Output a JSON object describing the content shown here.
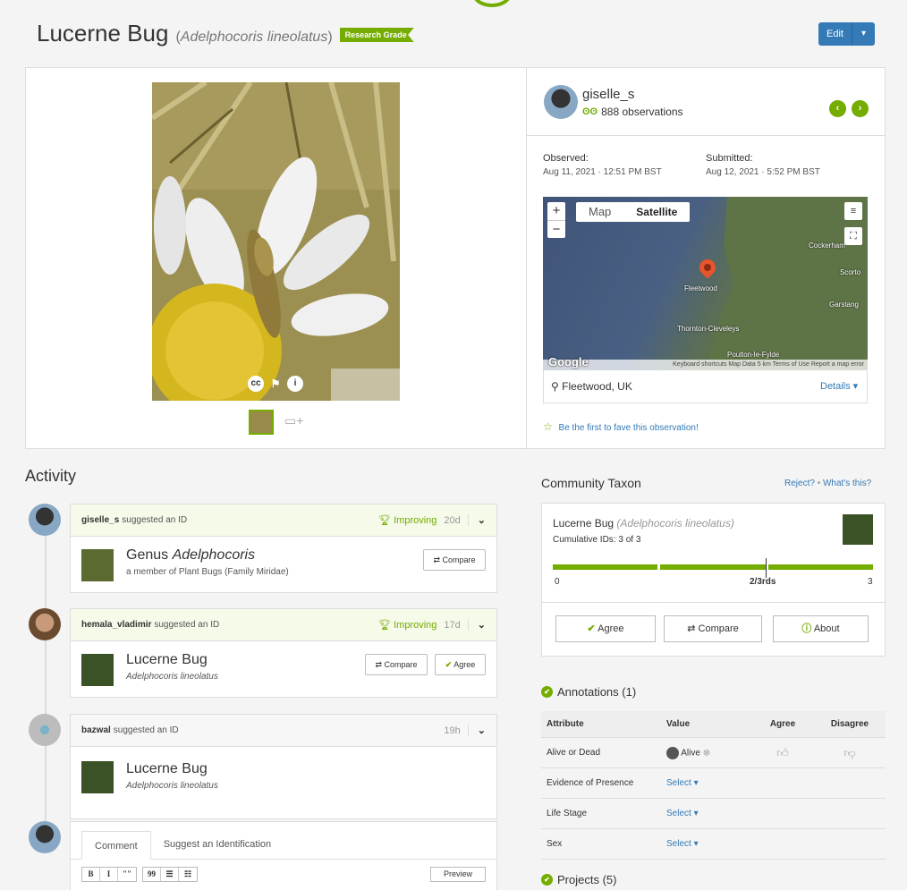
{
  "header": {
    "common_name": "Lucerne Bug",
    "sci_open": "(",
    "sci_name": "Adelphocoris lineolatus",
    "sci_close": ")",
    "badge": "Research Grade",
    "edit_label": "Edit",
    "edit_caret": "▾"
  },
  "colors": {
    "brand_green": "#74ac00",
    "link_blue": "#337ab7",
    "edit_blue": "#337ab7"
  },
  "observer": {
    "username": "giselle_s",
    "observations": "888 observations",
    "prev_arrow": "‹",
    "next_arrow": "›"
  },
  "dates": {
    "observed_label": "Observed:",
    "observed_value": "Aug 11, 2021 · 12:51 PM BST",
    "submitted_label": "Submitted:",
    "submitted_value": "Aug 12, 2021 · 5:52 PM BST"
  },
  "map": {
    "zoom_in": "+",
    "zoom_out": "−",
    "type_map": "Map",
    "type_satellite": "Satellite",
    "places": [
      "Fleetwood",
      "Thornton-Cleveleys",
      "Poulton-le-Fylde",
      "Cockerham",
      "Garstang",
      "Scorto"
    ],
    "google": "Google",
    "attribution": "Keyboard shortcuts   Map Data   5 km   Terms of Use   Report a map error",
    "location": "Fleetwood, UK",
    "details": "Details ▾"
  },
  "fave": "Be the first to fave this observation!",
  "photo_overlay": {
    "cc": "cc",
    "flag": "⚑",
    "info": "i"
  },
  "activity": {
    "title": "Activity",
    "items": [
      {
        "who": "giselle_s",
        "what": "suggested an ID",
        "status": "Improving",
        "age": "20d",
        "name_prefix": "Genus",
        "name": "Adelphocoris",
        "sub": "a member of Plant Bugs (Family Miridae)",
        "compare": "Compare"
      },
      {
        "who": "hemala_vladimir",
        "what": "suggested an ID",
        "status": "Improving",
        "age": "17d",
        "name": "Lucerne Bug",
        "sub": "Adelphocoris lineolatus",
        "compare": "Compare",
        "agree": "Agree"
      },
      {
        "who": "bazwal",
        "what": "suggested an ID",
        "age": "19h",
        "name": "Lucerne Bug",
        "sub": "Adelphocoris lineolatus"
      }
    ],
    "comment_tab": "Comment",
    "suggest_tab": "Suggest an Identification",
    "preview": "Preview",
    "toolbar": [
      "B",
      "I",
      "\"\"",
      "99",
      "☰",
      "☷"
    ]
  },
  "community": {
    "title": "Community Taxon",
    "reject": "Reject?",
    "sep": "•",
    "whats_this": "What's this?",
    "common": "Lucerne Bug",
    "sci": "(Adelphocoris lineolatus)",
    "cumulative": "Cumulative IDs: 3 of 3",
    "axis_min": "0",
    "axis_mid": "2/3rds",
    "axis_max": "3",
    "agree": "Agree",
    "compare": "Compare",
    "about": "About"
  },
  "annotations": {
    "title": "Annotations (1)",
    "headers": [
      "Attribute",
      "Value",
      "Agree",
      "Disagree"
    ],
    "rows": [
      {
        "attr": "Alive or Dead",
        "value": "Alive"
      },
      {
        "attr": "Evidence of Presence",
        "value": "Select ▾"
      },
      {
        "attr": "Life Stage",
        "value": "Select ▾"
      },
      {
        "attr": "Sex",
        "value": "Select ▾"
      }
    ]
  },
  "projects": {
    "title": "Projects (5)"
  }
}
